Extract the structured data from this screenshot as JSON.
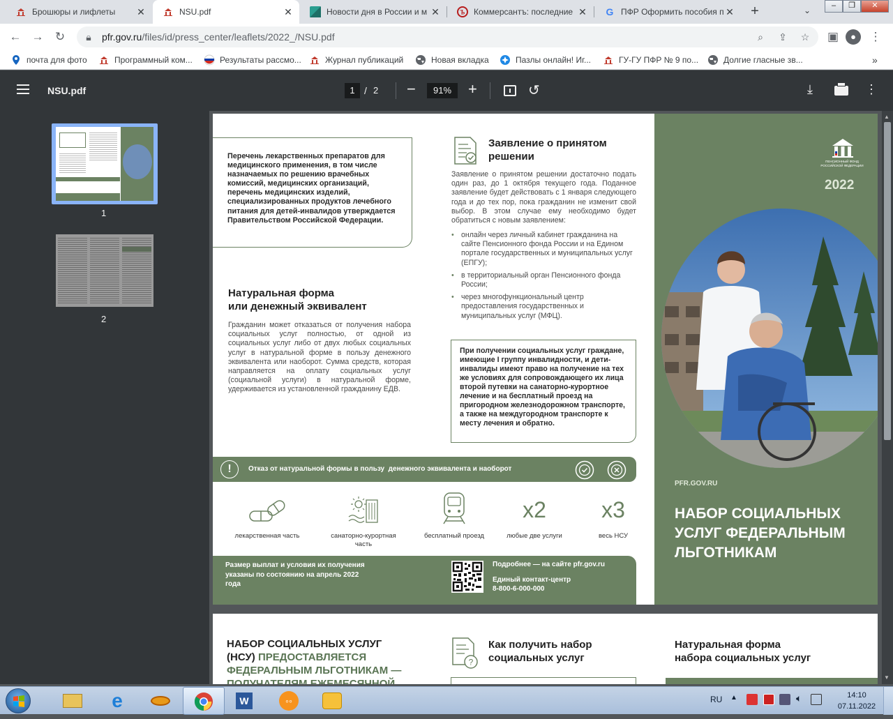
{
  "browser": {
    "tabs": [
      {
        "title": "Брошюры и лифлеты",
        "active": false
      },
      {
        "title": "NSU.pdf",
        "active": true
      },
      {
        "title": "Новости дня в России и м",
        "active": false
      },
      {
        "title": "Коммерсантъ: последние",
        "active": false
      },
      {
        "title": "ПФР Оформить пособия п",
        "active": false
      }
    ],
    "url_host": "pfr.gov.ru",
    "url_path": "/files/id/press_center/leaflets/2022_/NSU.pdf",
    "bookmarks": [
      "почта для фото",
      "Программный ком...",
      "Результаты рассмо...",
      "Журнал публикаций",
      "Новая вкладка",
      "Пазлы онлайн! Иг...",
      "ГУ-ГУ ПФР № 9 по...",
      "Долгие гласные зв..."
    ]
  },
  "pdf": {
    "filename": "NSU.pdf",
    "current_page": "1",
    "total_pages": "2",
    "zoom": "91%",
    "thumbnails": [
      "1",
      "2"
    ]
  },
  "leaflet": {
    "box1": "Перечень лекарственных препаратов для медицинского применения, в том числе назначаемых по решению врачебных комиссий, медицинских организаций, перечень медицинских изделий, специализированных продуктов лечебного питания для детей-инвалидов утверждается Правительством Российской Федерации.",
    "natural_title_1": "Натуральная форма",
    "natural_title_2": "или денежный эквивалент",
    "natural_text": "Гражданин может отказаться от получения набора социальных услуг полностью, от одной из социальных услуг либо от двух любых социальных услуг в натуральной форме в пользу денежного эквивалента или наоборот. Сумма средств, которая направляется на оплату социальных услуг (социальной услуги) в натуральной форме, удерживается из установленной гражданину ЕДВ.",
    "decision_title_1": "Заявление о принятом",
    "decision_title_2": "решении",
    "decision_text": "Заявление о принятом решении достаточно подать один раз, до 1 октября текущего года. Поданное заявление будет действовать с 1 января следующего года и до тех пор, пока гражданин не изменит свой выбор. В этом случае ему необходимо будет обратиться с новым заявлением:",
    "decision_items": [
      "онлайн через личный кабинет гражданина на сайте Пенсионного фонда России и на Едином портале государственных и муниципальных услуг (ЕПГУ);",
      "в территориальный орган Пенсионного фонда России;",
      "через многофункциональный центр предоставления государственных и муниципальных услуг (МФЦ)."
    ],
    "box2": "При получении социальных услуг граждане, имеющие I группу инвалидности, и дети-инвалиды имеют право на получение на тех же условиях для сопровождающего их лица второй путевки на санаторно-курортное лечение и на бесплатный проезд на пригородном железнодорожном транспорте, а также на междугородном транспорте к месту лечения и обратно.",
    "band_text": "Отказ от натуральной формы в пользу  денежного эквивалента и наоборот",
    "band_excl": "!",
    "icons": [
      {
        "label": "лекарственная часть",
        "icon": "pills-icon"
      },
      {
        "label": "санаторно-курортная часть",
        "icon": "sanatorium-icon"
      },
      {
        "label": "бесплатный проезд",
        "icon": "train-icon"
      },
      {
        "label": "любые две услуги",
        "big": "x2"
      },
      {
        "label": "весь НСУ",
        "big": "x3"
      }
    ],
    "footer_left": "Размер выплат и условия их получения указаны по состоянию на апрель 2022 года",
    "footer_more": "Подробнее — на сайте pfr.gov.ru",
    "footer_center_label": "Единый контакт-центр",
    "footer_phone": "8-800-6-000-000",
    "cover_year": "2022",
    "cover_logo_text": "ПЕНСИОННЫЙ ФОНД РОССИЙСКОЙ ФЕДЕРАЦИИ",
    "cover_site": "PFR.GOV.RU",
    "cover_title": "НАБОР СОЦИАЛЬНЫХ УСЛУГ ФЕДЕРАЛЬНЫМ ЛЬГОТНИКАМ"
  },
  "page2": {
    "title_black": "НАБОР СОЦИАЛЬНЫХ УСЛУГ (НСУ)",
    "title_green": "ПРЕДОСТАВЛЯЕТСЯ ФЕДЕРАЛЬНЫМ ЛЬГОТНИКАМ — ПОЛУЧАТЕЛЯМ ЕЖЕМЕСЯЧНОЙ",
    "how_title_1": "Как получить набор",
    "how_title_2": "социальных услуг",
    "natural_title_1": "Натуральная форма",
    "natural_title_2": "набора социальных услуг"
  },
  "taskbar": {
    "lang": "RU",
    "time": "14:10",
    "date": "07.11.2022"
  }
}
